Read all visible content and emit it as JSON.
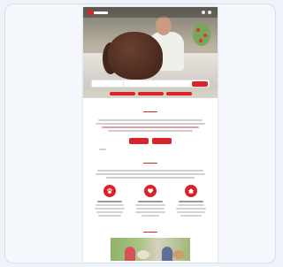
{
  "header": {
    "logo_text": ""
  },
  "hero": {
    "title": "",
    "image": "woman-with-brown-dog-on-sofa",
    "search": {
      "category": "",
      "placeholder": ""
    },
    "quick_links": [
      "",
      "",
      ""
    ]
  },
  "intro": {
    "title": "",
    "buttons": [
      "",
      ""
    ]
  },
  "how_it_works": {
    "title": "",
    "features": [
      {
        "icon": "paw-icon",
        "title": ""
      },
      {
        "icon": "heart-icon",
        "title": ""
      },
      {
        "icon": "home-icon",
        "title": ""
      }
    ]
  },
  "gallery": {
    "title": ""
  },
  "colors": {
    "accent": "#d8232a",
    "background": "#eef2f9",
    "page": "#ffffff"
  }
}
